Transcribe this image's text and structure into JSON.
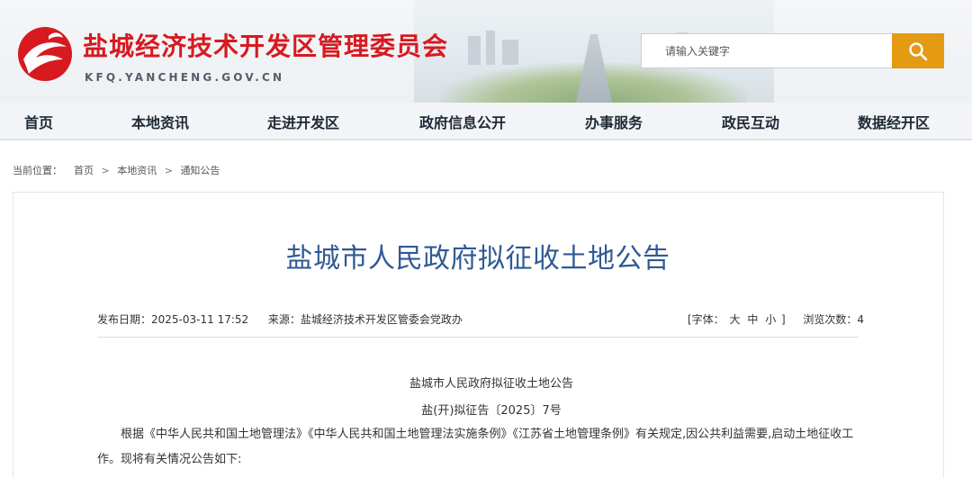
{
  "header": {
    "site_title": "盐城经济技术开发区管理委员会",
    "site_domain": "KFQ.YANCHENG.GOV.CN",
    "logo_icon": "swan-emblem-icon",
    "search": {
      "placeholder": "请输入关键字",
      "button_icon": "search-icon"
    }
  },
  "nav": {
    "items": [
      {
        "label": "首页"
      },
      {
        "label": "本地资讯"
      },
      {
        "label": "走进开发区"
      },
      {
        "label": "政府信息公开"
      },
      {
        "label": "办事服务"
      },
      {
        "label": "政民互动"
      },
      {
        "label": "数据经开区"
      }
    ]
  },
  "breadcrumb": {
    "prefix": "当前位置：",
    "items": [
      "首页",
      "本地资讯",
      "通知公告"
    ],
    "separator": ">"
  },
  "article": {
    "title": "盐城市人民政府拟征收土地公告",
    "meta": {
      "date_label": "发布日期：",
      "date_value": "2025-03-11 17:52",
      "source_label": "来源：",
      "source_value": "盐城经济技术开发区管委会党政办",
      "font_label": "[字体：",
      "font_large": "大",
      "font_medium": "中",
      "font_small": "小",
      "font_end": "]",
      "views_label": "浏览次数：",
      "views_value": "4"
    },
    "body": {
      "heading": "盐城市人民政府拟征收土地公告",
      "doc_no": "盐(开)拟征告〔2025〕7号",
      "paragraph": "根据《中华人民共和国土地管理法》《中华人民共和国土地管理法实施条例》《江苏省土地管理条例》有关规定,因公共利益需要,启动土地征收工作。现将有关情况公告如下:"
    }
  },
  "colors": {
    "brand_red": "#d71920",
    "title_blue": "#2f5a95",
    "search_orange": "#e59a14"
  }
}
